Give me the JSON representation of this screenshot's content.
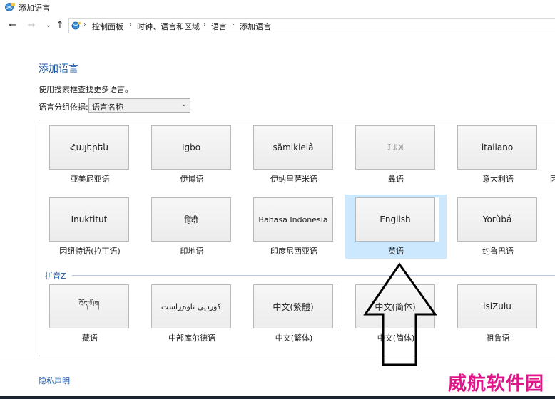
{
  "window": {
    "title": "添加语言"
  },
  "nav": {
    "back_glyph": "←",
    "forward_glyph": "→",
    "recent_glyph": "⌄",
    "up_glyph": "↑",
    "breadcrumb": [
      "控制面板",
      "时钟、语言和区域",
      "语言",
      "添加语言"
    ],
    "separator": "›"
  },
  "main": {
    "heading": "添加语言",
    "hint": "使用搜索框查找更多语言。",
    "group_label": "语言分组依据:",
    "group_value": "语言名称"
  },
  "languages_row1": [
    {
      "native": "Հայերեն",
      "name": "亚美尼亚语",
      "stack": false
    },
    {
      "native": "Igbo",
      "name": "伊博语",
      "stack": false
    },
    {
      "native": "sämikielâ",
      "name": "伊纳里萨米语",
      "stack": false
    },
    {
      "native": "ꆈꌠꉙ",
      "name": "彝语",
      "stack": false
    },
    {
      "native": "italiano",
      "name": "意大利语",
      "stack": true
    }
  ],
  "languages_row2": [
    {
      "native": "Inuktitut",
      "name": "因纽特语(拉丁语)",
      "stack": false
    },
    {
      "native": "हिंदी",
      "name": "印地语",
      "stack": false
    },
    {
      "native": "Bahasa Indonesia",
      "name": "印度尼西亚语",
      "stack": false
    },
    {
      "native": "English",
      "name": "英语",
      "stack": true,
      "selected": true
    },
    {
      "native": "Yorùbá",
      "name": "约鲁巴语",
      "stack": false
    }
  ],
  "section": {
    "label": "拼音Z"
  },
  "languages_row3": [
    {
      "native": "བོད་ཡིག",
      "name": "藏语",
      "stack": false
    },
    {
      "native": "کوردیی ناوەڕاست",
      "name": "中部库尔德语",
      "stack": false
    },
    {
      "native": "中文(繁體)",
      "name": "中文(繁体)",
      "stack": true
    },
    {
      "native": "中文(简体)",
      "name": "中文(简体)",
      "stack": true
    },
    {
      "native": "isiZulu",
      "name": "祖鲁语",
      "stack": false
    }
  ],
  "partial_next": "因",
  "footer": {
    "privacy": "隐私声明"
  },
  "watermark": "威航软件园",
  "annotation": {
    "arrow_color": "#000000"
  }
}
